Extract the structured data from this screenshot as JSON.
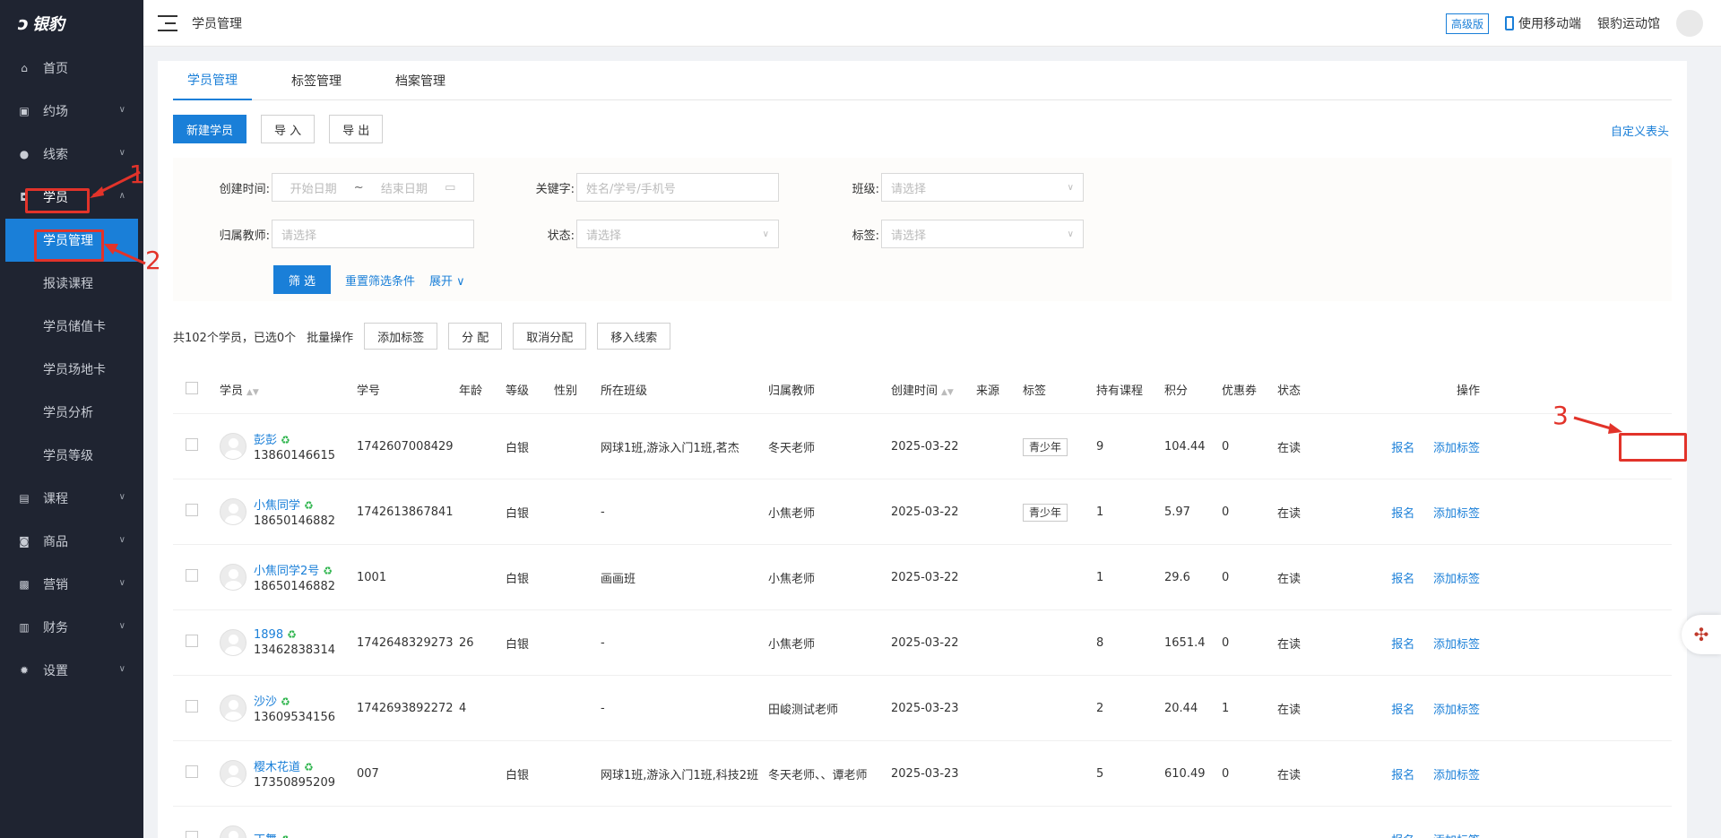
{
  "logo": {
    "mark": "ↄ",
    "text": "银豹"
  },
  "sidebar": {
    "items": [
      {
        "label": "首页",
        "icon": "home-icon",
        "glyph": "⌂"
      },
      {
        "label": "约场",
        "icon": "calendar-icon",
        "glyph": "▣"
      },
      {
        "label": "线索",
        "icon": "user-icon",
        "glyph": "●"
      },
      {
        "label": "学员",
        "icon": "student-icon",
        "glyph": "◘"
      },
      {
        "label": "课程",
        "icon": "book-icon",
        "glyph": "▤"
      },
      {
        "label": "商品",
        "icon": "bag-icon",
        "glyph": "◙"
      },
      {
        "label": "营销",
        "icon": "ticket-icon",
        "glyph": "▩"
      },
      {
        "label": "财务",
        "icon": "money-icon",
        "glyph": "▥"
      },
      {
        "label": "设置",
        "icon": "gear-icon",
        "glyph": "✹"
      }
    ],
    "sub_items": [
      "学员管理",
      "报读课程",
      "学员储值卡",
      "学员场地卡",
      "学员分析",
      "学员等级"
    ]
  },
  "header": {
    "breadcrumb": "学员管理",
    "edition": "高级版",
    "mobile": "使用移动端",
    "venue": "银豹运动馆"
  },
  "tabs": [
    "学员管理",
    "标签管理",
    "档案管理"
  ],
  "toolbar": {
    "new": "新建学员",
    "import": "导 入",
    "export": "导 出",
    "custom": "自定义表头"
  },
  "filter": {
    "created_label": "创建时间:",
    "start_ph": "开始日期",
    "sep": "~",
    "end_ph": "结束日期",
    "keyword_label": "关键字:",
    "keyword_ph": "姓名/学号/手机号",
    "class_label": "班级:",
    "select_ph": "请选择",
    "teacher_label": "归属教师:",
    "status_label": "状态:",
    "tag_label": "标签:",
    "filter_btn": "筛 选",
    "reset": "重置筛选条件",
    "expand": "展开"
  },
  "summary": {
    "count": "共102个学员，已选0个",
    "batch": "批量操作",
    "add_tag": "添加标签",
    "assign": "分 配",
    "unassign": "取消分配",
    "move": "移入线索"
  },
  "columns": [
    "学员",
    "学号",
    "年龄",
    "等级",
    "性别",
    "所在班级",
    "归属教师",
    "创建时间",
    "来源",
    "标签",
    "持有课程",
    "积分",
    "优惠券",
    "状态",
    "操作"
  ],
  "rows": [
    {
      "name": "彭彭",
      "phone": "13860146615",
      "sid": "1742607008429",
      "age": "",
      "level": "白银",
      "gender": "",
      "class": "网球1班,游泳入门1班,茗杰",
      "teacher": "冬天老师",
      "created": "2025-03-22",
      "source": "",
      "tag": "青少年",
      "courses": "9",
      "points": "104.44",
      "coupons": "0",
      "status": "在读"
    },
    {
      "name": "小焦同学",
      "phone": "18650146882",
      "sid": "1742613867841",
      "age": "",
      "level": "白银",
      "gender": "",
      "class": "-",
      "teacher": "小焦老师",
      "created": "2025-03-22",
      "source": "",
      "tag": "青少年",
      "courses": "1",
      "points": "5.97",
      "coupons": "0",
      "status": "在读"
    },
    {
      "name": "小焦同学2号",
      "phone": "18650146882",
      "sid": "1001",
      "age": "",
      "level": "白银",
      "gender": "",
      "class": "画画班",
      "teacher": "小焦老师",
      "created": "2025-03-22",
      "source": "",
      "tag": "",
      "courses": "1",
      "points": "29.6",
      "coupons": "0",
      "status": "在读"
    },
    {
      "name": "1898",
      "phone": "13462838314",
      "sid": "1742648329273",
      "age": "26",
      "level": "白银",
      "gender": "",
      "class": "-",
      "teacher": "小焦老师",
      "created": "2025-03-22",
      "source": "",
      "tag": "",
      "courses": "8",
      "points": "1651.4",
      "coupons": "0",
      "status": "在读"
    },
    {
      "name": "沙沙",
      "phone": "13609534156",
      "sid": "1742693892272",
      "age": "4",
      "level": "",
      "gender": "",
      "class": "-",
      "teacher": "田峻测试老师",
      "created": "2025-03-23",
      "source": "",
      "tag": "",
      "courses": "2",
      "points": "20.44",
      "coupons": "1",
      "status": "在读"
    },
    {
      "name": "樱木花道",
      "phone": "17350895209",
      "sid": "007",
      "age": "",
      "level": "白银",
      "gender": "",
      "class": "网球1班,游泳入门1班,科技2班",
      "teacher": "冬天老师、、谭老师",
      "created": "2025-03-23",
      "source": "",
      "tag": "",
      "courses": "5",
      "points": "610.49",
      "coupons": "0",
      "status": "在读"
    },
    {
      "name": "丁舞",
      "phone": "",
      "sid": "",
      "age": "",
      "level": "",
      "gender": "",
      "class": "",
      "teacher": "",
      "created": "",
      "source": "",
      "tag": "",
      "courses": "",
      "points": "",
      "coupons": "",
      "status": ""
    }
  ],
  "actions": {
    "enroll": "报名",
    "add_tag": "添加标签"
  },
  "annotations": [
    "1",
    "2",
    "3"
  ],
  "colors": {
    "primary": "#1a7fd8",
    "sidebar": "#1f2431",
    "annotation": "#e2332a"
  }
}
